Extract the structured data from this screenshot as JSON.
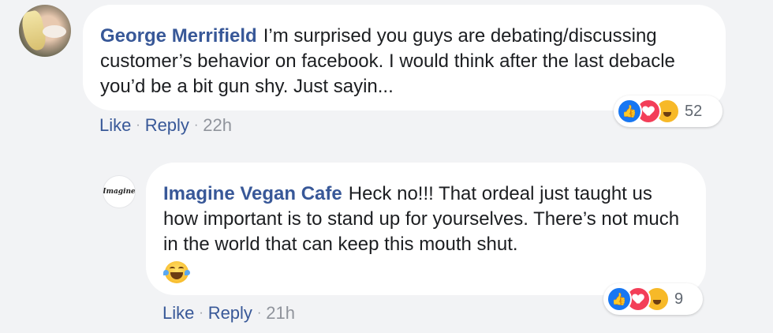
{
  "comments": [
    {
      "author": "George Merrifield",
      "text": "I’m surprised you guys are debating/discussing customer’s behavior on facebook. I would think after the last debacle you’d be a bit gun shy. Just sayin...",
      "reaction_count": "52",
      "actions": {
        "like": "Like",
        "reply": "Reply",
        "time": "22h",
        "separator": "·"
      }
    },
    {
      "author": "Imagine Vegan Cafe",
      "avatar_text": "Imagine",
      "text": "Heck no!!! That ordeal just taught us how important is to stand up for yourselves. There’s not much in the world that can keep this mouth shut.",
      "reaction_count": "9",
      "actions": {
        "like": "Like",
        "reply": "Reply",
        "time": "21h",
        "separator": "·"
      }
    }
  ],
  "colors": {
    "background": "#f2f3f5",
    "author": "#385898",
    "like": "#1877f2",
    "love": "#f33e58",
    "haha": "#f7b928",
    "meta": "#90949c"
  },
  "icons": [
    "like-reaction-icon",
    "love-reaction-icon",
    "haha-reaction-icon",
    "tears-of-joy-emoji"
  ]
}
